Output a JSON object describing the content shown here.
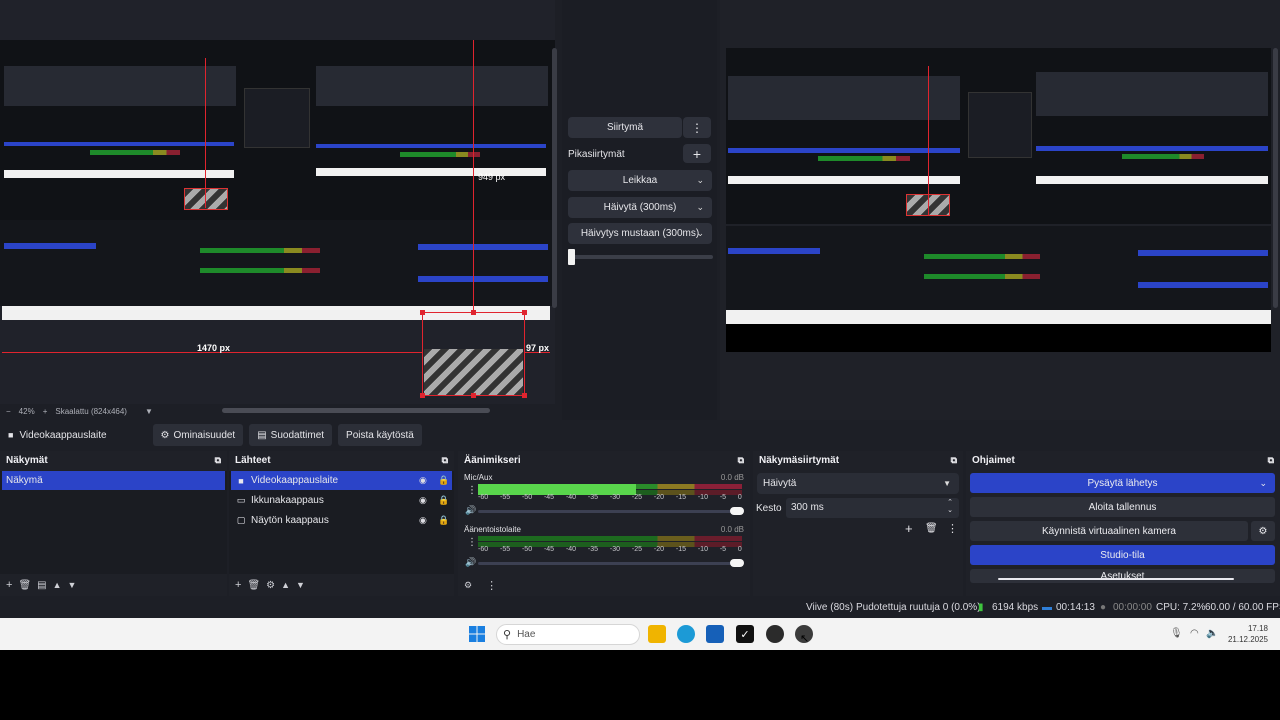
{
  "preview": {
    "zoom": "42%",
    "scale_label": "Skaalattu (824x464)",
    "guide_left_label": "1470 px",
    "guide_right_label": "97 px",
    "guide_top_label": "949 px"
  },
  "transitions": {
    "transition_button": "Siirtymä",
    "quick_transitions_label": "Pikasiirtymät",
    "quick_items": [
      "Leikkaa",
      "Häivytä (300ms)",
      "Häivytys mustaan (300ms)"
    ]
  },
  "context_bar": {
    "source_name": "Videokaappauslaite",
    "properties": "Ominaisuudet",
    "filters": "Suodattimet",
    "deactivate": "Poista käytöstä"
  },
  "scenes_dock": {
    "title": "Näkymät",
    "items": [
      "Näkymä"
    ]
  },
  "sources_dock": {
    "title": "Lähteet",
    "items": [
      {
        "name": "Videokaappauslaite",
        "icon": "camera-icon"
      },
      {
        "name": "Ikkunakaappaus",
        "icon": "window-icon"
      },
      {
        "name": "Näytön kaappaus",
        "icon": "monitor-icon"
      }
    ]
  },
  "mixer_dock": {
    "title": "Äänimikseri",
    "channels": [
      {
        "name": "Mic/Aux",
        "db": "0.0 dB",
        "level": 0.6
      },
      {
        "name": "Äänentoistolaite",
        "db": "0.0 dB",
        "level": 0.0
      }
    ],
    "ticks": [
      "-60",
      "-55",
      "-50",
      "-45",
      "-40",
      "-35",
      "-30",
      "-25",
      "-20",
      "-15",
      "-10",
      "-5",
      "0"
    ]
  },
  "transitions_dock": {
    "title": "Näkymäsiirtymät",
    "selected": "Häivytä",
    "duration_label": "Kesto",
    "duration_value": "300 ms"
  },
  "controls_dock": {
    "title": "Ohjaimet",
    "stop_stream": "Pysäytä lähetys",
    "start_recording": "Aloita tallennus",
    "virtual_camera": "Käynnistä virtuaalinen kamera",
    "studio_mode": "Studio-tila",
    "settings": "Asetukset"
  },
  "status_bar": {
    "delay": "Viive (80s)",
    "dropped_frames": "Pudotettuja ruutuja 0 (0.0%)",
    "bitrate": "6194 kbps",
    "stream_time": "00:14:13",
    "record_time": "00:00:00",
    "cpu": "CPU: 7.2%",
    "fps": "60.00 / 60.00 FPS"
  },
  "taskbar": {
    "search_placeholder": "Hae",
    "time": "17.18",
    "date": "21.12.2025"
  },
  "colors": {
    "accent_blue": "#2b44c8",
    "guide_red": "#e0242e",
    "panel_bg": "#1f2128",
    "bitrate_green": "#3ec43e",
    "stream_blue": "#2f7fd8"
  }
}
